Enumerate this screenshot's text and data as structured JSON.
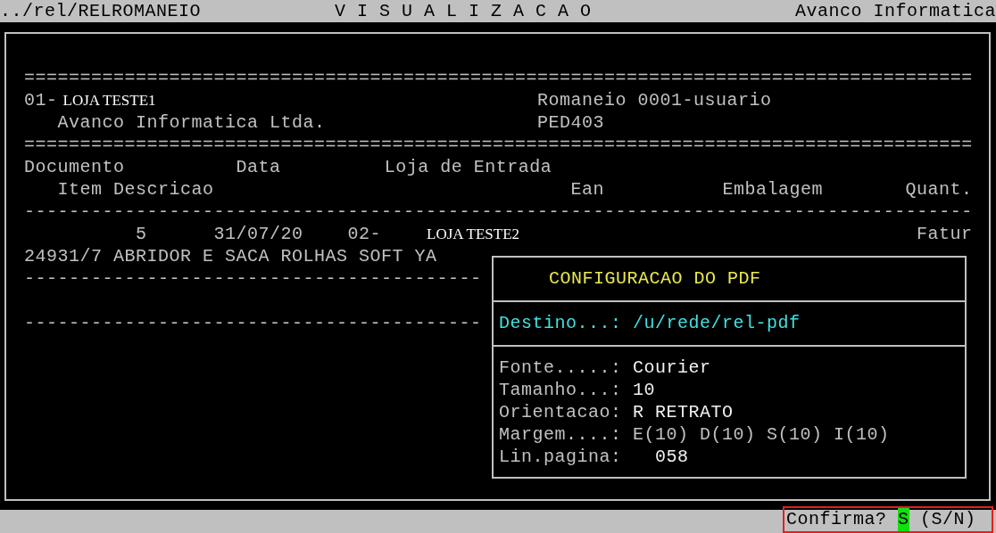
{
  "title_bar": {
    "path": "../rel/RELROMANEIO",
    "title": "V I S U A L I Z A C A O",
    "company": "Avanco Informatica"
  },
  "report": {
    "separator_1": "=====================================================================================",
    "store": {
      "code": "01-",
      "name": "LOJA TESTE1"
    },
    "romaneio": "Romaneio 0001-usuario",
    "company": "Avanco Informatica Ltda.",
    "program": "PED403",
    "separator_2": "=====================================================================================",
    "header_1": [
      "Documento",
      "Data",
      "Loja de Entrada"
    ],
    "header_2": [
      "Item Descricao",
      "Ean",
      "Embalagem",
      "Quant."
    ],
    "separator_3": "-------------------------------------------------------------------------------------",
    "document": {
      "number": "5",
      "date": "31/07/20",
      "store_code": "02-",
      "store_name": "LOJA TESTE2",
      "status": "Fatur"
    },
    "item": "24931/7 ABRIDOR E SACA ROLHAS SOFT YA",
    "separator_4": "-----------------------------------------",
    "separator_5": "-----------------------------------------"
  },
  "pdf_dialog": {
    "title": "CONFIGURACAO DO PDF",
    "destination": {
      "label": "Destino...:",
      "value": "/u/rede/rel-pdf"
    },
    "fields": [
      {
        "label": "Fonte.....:",
        "value": "Courier",
        "kind": "bright"
      },
      {
        "label": "Tamanho...:",
        "value": "10",
        "kind": "bright"
      },
      {
        "label": "Orientacao:",
        "value": "R RETRATO",
        "kind": "bright"
      },
      {
        "label": "Margem....:",
        "value": "E(10) D(10) S(10) I(10)",
        "kind": "dim"
      },
      {
        "label": "Lin.pagina:",
        "value": "058",
        "kind": "indented"
      }
    ]
  },
  "prompt": {
    "label": "Confirma?",
    "answer": "S",
    "options": "(S/N)"
  }
}
